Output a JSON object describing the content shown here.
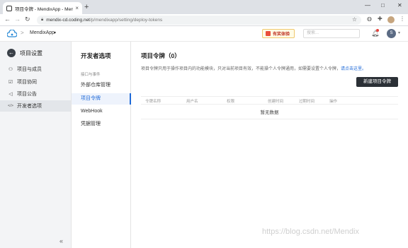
{
  "browser": {
    "tab_title": "项目令牌 - MendixApp - Mendix",
    "tab_close": "×",
    "new_tab": "+",
    "url_host": "mendix-cd.coding.net",
    "url_path": "/p/mendixapp/setting/deploy-tokens",
    "back": "←",
    "forward": "→",
    "reload": "↻",
    "window_controls": [
      "—",
      "□",
      "✕"
    ]
  },
  "header": {
    "project_name": "MendixApp",
    "project_caret": "▾",
    "breadcrumb_sep": ">",
    "promo_label": "有奖体验",
    "search_placeholder": "搜索...",
    "user_initial": "S",
    "user_caret": "▾",
    "colors": {
      "logo": "#2b8bd6",
      "promo_border": "#f0c86e",
      "badge": "#e5413b"
    }
  },
  "sidebar": {
    "title": "项目设置",
    "back_icon": "←",
    "items": [
      {
        "label": "项目与成员",
        "icon": "users-icon",
        "glyph": "⚇",
        "active": false
      },
      {
        "label": "项目协同",
        "icon": "collab-icon",
        "glyph": "☑",
        "active": false
      },
      {
        "label": "项目公告",
        "icon": "announce-icon",
        "glyph": "◁",
        "active": false
      },
      {
        "label": "开发者选项",
        "icon": "code-icon",
        "glyph": "</>",
        "active": true
      }
    ],
    "collapse_glyph": "«"
  },
  "submenu": {
    "title": "开发者选项",
    "group_label": "接口与事件",
    "items": [
      {
        "label": "外部仓库管理",
        "active": false
      },
      {
        "label": "项目令牌",
        "active": true
      },
      {
        "label": "WebHook",
        "active": false
      },
      {
        "label": "凭据管理",
        "active": false
      }
    ]
  },
  "main": {
    "title": "项目令牌（0）",
    "description": "项目令牌只用于操作项目内的功能模块，只对当前项目有效，不能操个人令牌通用，如需要设置个人令牌，",
    "description_link": "请点击这里。",
    "new_button": "新建项目令牌",
    "columns": [
      "令牌名称",
      "用户名",
      "权限",
      "创建时间",
      "过期时间",
      "操作"
    ],
    "empty_text": "暂无数据",
    "accent_color": "#1f6ad8"
  },
  "watermark": "https://blog.csdn.net/Mendix"
}
